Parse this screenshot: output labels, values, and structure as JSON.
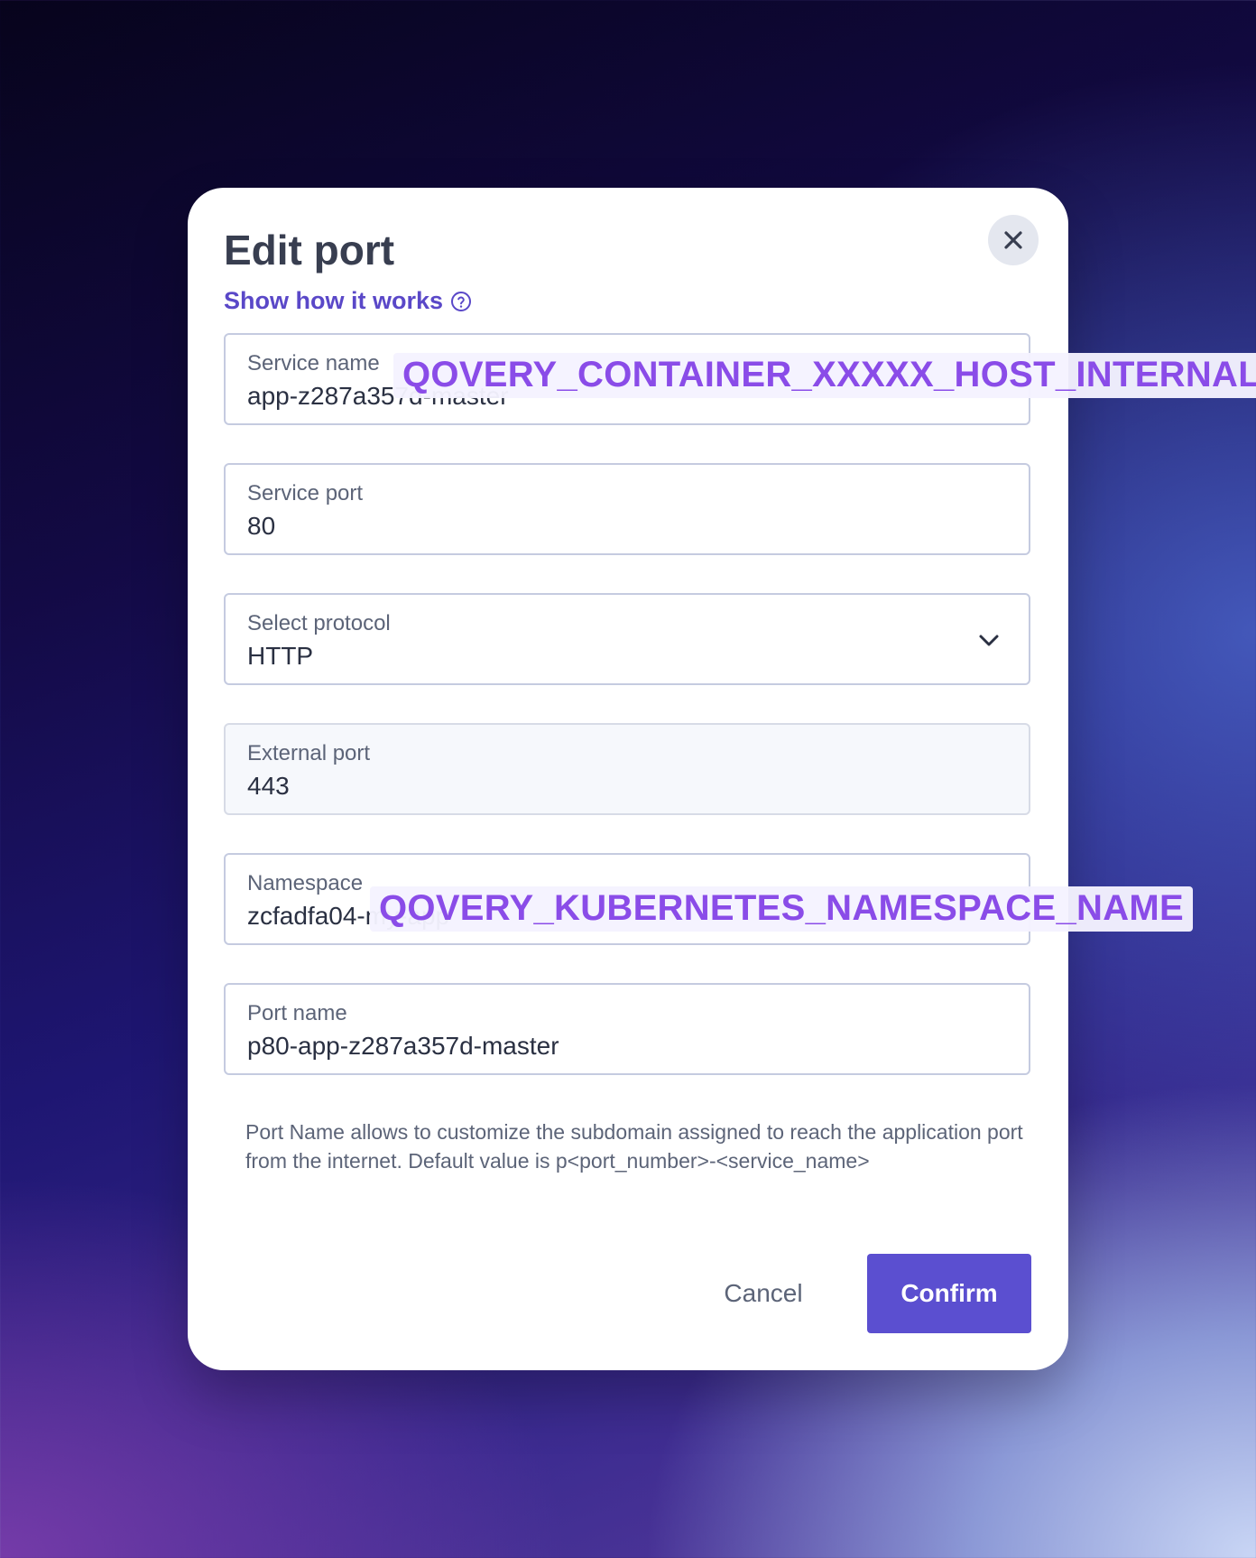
{
  "modal": {
    "title": "Edit port",
    "help_link": "Show how it works",
    "close_icon": "close-icon"
  },
  "fields": {
    "service_name": {
      "label": "Service name",
      "value": "app-z287a357d-master"
    },
    "service_port": {
      "label": "Service port",
      "value": "80"
    },
    "protocol": {
      "label": "Select protocol",
      "value": "HTTP"
    },
    "external_port": {
      "label": "External port",
      "value": "443"
    },
    "namespace": {
      "label": "Namespace",
      "value": "zcfadfa04-my-app"
    },
    "port_name": {
      "label": "Port name",
      "value": "p80-app-z287a357d-master"
    }
  },
  "env_badges": {
    "host_internal": "QOVERY_CONTAINER_XXXXX_HOST_INTERNAL",
    "namespace": "QOVERY_KUBERNETES_NAMESPACE_NAME"
  },
  "port_name_hint": "Port Name allows to customize the subdomain assigned to reach the application port from the internet. Default value is p<port_number>-<service_name>",
  "actions": {
    "cancel": "Cancel",
    "confirm": "Confirm"
  },
  "colors": {
    "accent": "#5b4fd0",
    "badge_text": "#8a4ce8",
    "title": "#383e50"
  }
}
